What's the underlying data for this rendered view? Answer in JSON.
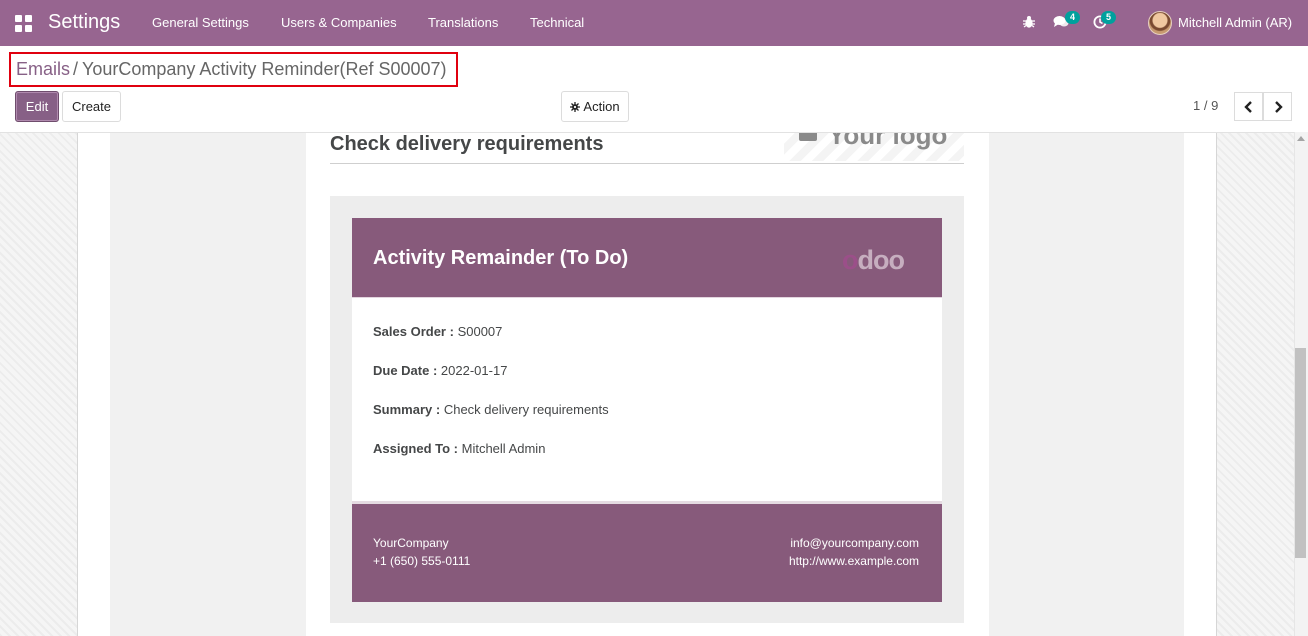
{
  "navbar": {
    "apps_icon": "apps-grid-icon",
    "brand": "Settings",
    "menu": [
      "General Settings",
      "Users & Companies",
      "Translations",
      "Technical"
    ],
    "debug_icon": "bug-icon",
    "messages_icon": "chat-icon",
    "messages_count": "4",
    "activities_icon": "clock-icon",
    "activities_count": "5",
    "user_name": "Mitchell Admin (AR)",
    "accent_color": "#976590"
  },
  "breadcrumb": {
    "parent": "Emails",
    "separator": "/",
    "current": "YourCompany Activity Reminder(Ref S00007)"
  },
  "toolbar": {
    "edit_label": "Edit",
    "create_label": "Create",
    "action_label": "Action",
    "action_icon": "gear-icon"
  },
  "pager": {
    "value": "1 / 9",
    "prev_icon": "chevron-left-icon",
    "next_icon": "chevron-right-icon"
  },
  "email": {
    "subject": "Check delivery requirements",
    "logo_placeholder": "Your logo",
    "header_title": "Activity Remainder (To Do)",
    "header_logo": "odoo",
    "fields": [
      {
        "label": "Sales Order :",
        "value": "S00007"
      },
      {
        "label": "Due Date :",
        "value": "2022-01-17"
      },
      {
        "label": "Summary :",
        "value": "Check delivery requirements"
      },
      {
        "label": "Assigned To :",
        "value": "Mitchell Admin"
      }
    ],
    "footer": {
      "company": "YourCompany",
      "phone": "+1 (650) 555-0111",
      "email": "info@yourcompany.com",
      "website": "http://www.example.com"
    },
    "brand_color": "#875a7b"
  }
}
